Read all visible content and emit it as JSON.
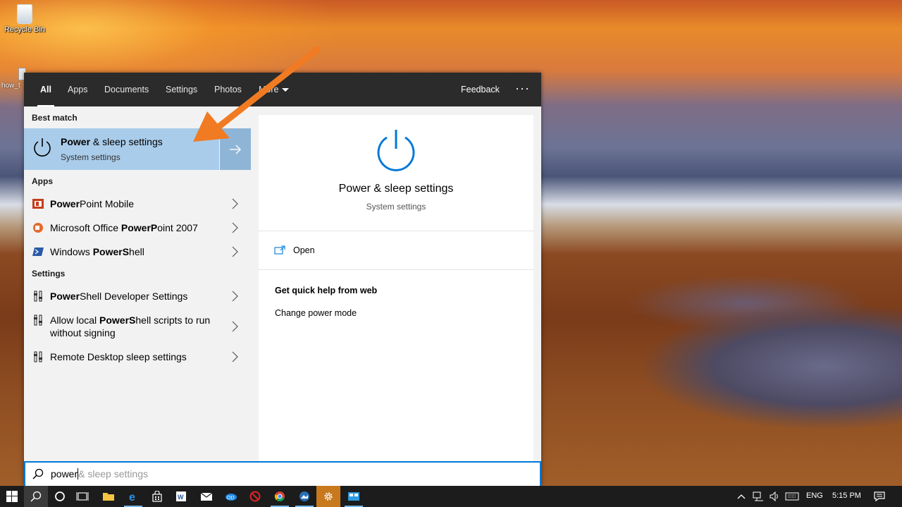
{
  "desktop": {
    "icons": [
      {
        "label": "Recycle Bin",
        "icon": "recycle-bin-icon"
      },
      {
        "label": "how_t",
        "icon": "document-icon"
      }
    ]
  },
  "search": {
    "tabs": [
      {
        "label": "All",
        "active": true
      },
      {
        "label": "Apps"
      },
      {
        "label": "Documents"
      },
      {
        "label": "Settings"
      },
      {
        "label": "Photos"
      },
      {
        "label": "More"
      }
    ],
    "feedback_label": "Feedback",
    "more_options": "···",
    "best_match": {
      "heading": "Best match",
      "title_bold": "Power",
      "title_rest": " & sleep settings",
      "subtitle": "System settings",
      "icon": "power-icon"
    },
    "apps": {
      "heading": "Apps",
      "items": [
        {
          "bold": "Power",
          "rest": "Point Mobile",
          "pre": "",
          "icon": "powerpoint-icon"
        },
        {
          "pre": "Microsoft Office ",
          "bold": "PowerP",
          "rest": "oint 2007",
          "icon": "powerpoint-2007-icon"
        },
        {
          "pre": "Windows ",
          "bold": "PowerS",
          "rest": "hell",
          "icon": "powershell-icon"
        }
      ]
    },
    "settings": {
      "heading": "Settings",
      "items": [
        {
          "pre": "",
          "bold": "Power",
          "rest": "Shell Developer Settings",
          "icon": "settings-icon"
        },
        {
          "pre": "Allow local ",
          "bold": "PowerS",
          "rest": "hell scripts to run",
          "line2": "without signing",
          "icon": "settings-icon"
        },
        {
          "pre": "Remote Desktop sleep settings",
          "bold": "",
          "rest": "",
          "icon": "settings-icon"
        }
      ]
    },
    "detail": {
      "title": "Power & sleep settings",
      "subtitle": "System settings",
      "open_label": "Open",
      "help_heading": "Get quick help from web",
      "help_items": [
        "Change power mode"
      ]
    },
    "query": "power",
    "query_suggestion": "& sleep settings"
  },
  "taskbar": {
    "language": "ENG",
    "time": "5:15 PM"
  },
  "colors": {
    "accent": "#0078d7",
    "best_match_bg": "#a9ccea",
    "arrow": "#f07b22"
  }
}
